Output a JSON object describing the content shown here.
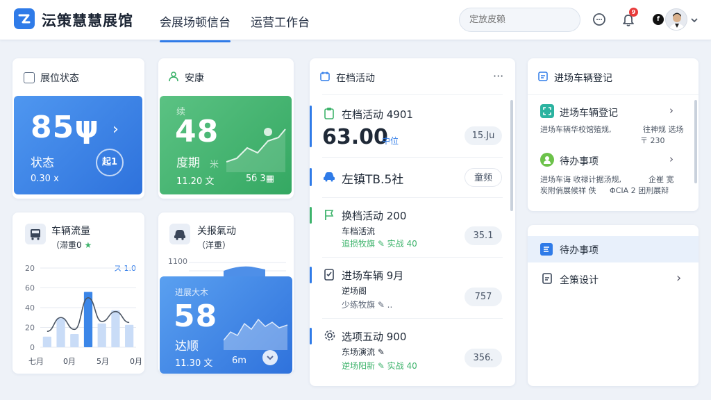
{
  "header": {
    "app_title": "沄策慧慧展馆",
    "tabs": [
      {
        "label": "会展场顿信台",
        "active": true
      },
      {
        "label": "运营工作台",
        "active": false
      }
    ],
    "search_placeholder": "定放皮赖",
    "notification_count": "9",
    "avatar_letter": "f"
  },
  "booth_status": {
    "title": "展位状态",
    "value": "85ψ",
    "label": "状态",
    "foot": "0.30 ⅹ",
    "arrow": "›",
    "badge": "起1"
  },
  "visitors": {
    "title": "安康",
    "top_label": "续",
    "value": "48",
    "label": "度期",
    "label_suffix": "米",
    "foot": "11.20 文",
    "foot_right": "5б 3▦"
  },
  "traffic": {
    "title": "车辆流量",
    "subtitle": "（滞重0",
    "subtitle_mark": "★",
    "legend": "ス 1.0",
    "y_ticks": [
      "20",
      "60",
      "40",
      "20",
      "0"
    ],
    "x_ticks": [
      "七月",
      "0月",
      "5月",
      "0月"
    ]
  },
  "register_activity": {
    "title": "关报氣动",
    "subtitle": "（洋重）",
    "y_top": "1100",
    "card_label": "进展大木",
    "value": "58",
    "label": "达顺",
    "foot": "11.30 文",
    "foot_right": "6m"
  },
  "activities": {
    "title": "在档活动",
    "more": "···",
    "items": [
      {
        "title": "在档活动 4901",
        "sub": "63.00",
        "sub_extra": "中位",
        "pill": "15.Ju",
        "color": "#2f7be8"
      },
      {
        "title": "左镇TB.5社",
        "sub": "",
        "sub_extra": "",
        "pill": "童频",
        "color": "#2f7be8"
      },
      {
        "title": "换档活动 200",
        "sub": "车档活流",
        "sub_extra": "追损牧旗 ✎  实战 40",
        "pill": "35.1",
        "color": "#3db36b"
      },
      {
        "title": "进场车辆 9月",
        "sub": "逆场阁",
        "sub_extra": "少练牧旗 ✎ ..",
        "pill": "757",
        "color": "#2f7be8"
      },
      {
        "title": "选项五动 900",
        "sub": "东场演流 ✎",
        "sub_extra": "逆场阳新 ✎  实战 40",
        "pill": "356.",
        "color": "#2f7be8"
      }
    ]
  },
  "vehicle_reg": {
    "title": "进场车辆登记",
    "entry_title": "进场车辆登记",
    "entry_sub1": "进场车辆华校馆殖规,",
    "entry_sub1b": "往神规 选场",
    "entry_sub2": "〒 230",
    "todo_title": "待办事项",
    "todo_sub1": "进场车诲 收禄计据汤规,",
    "todo_sub1b": "企崔 宽",
    "todo_sub2": "炭附俏展候祥 佚",
    "todo_sub2b": "ΦCIA 2 团刑展辩"
  },
  "todo_panel": {
    "title": "待办事项",
    "item": "全策设计"
  },
  "colors": {
    "primary": "#2f7be8",
    "green": "#3db36b",
    "background": "#eef2f8"
  },
  "chart_data": {
    "type": "bar",
    "categories": [
      "七月",
      "",
      "0月",
      "",
      "5月",
      "",
      "0月"
    ],
    "series": [
      {
        "values": [
          8,
          22,
          10,
          42,
          18,
          28,
          17
        ]
      }
    ],
    "ylim": [
      0,
      60
    ]
  }
}
